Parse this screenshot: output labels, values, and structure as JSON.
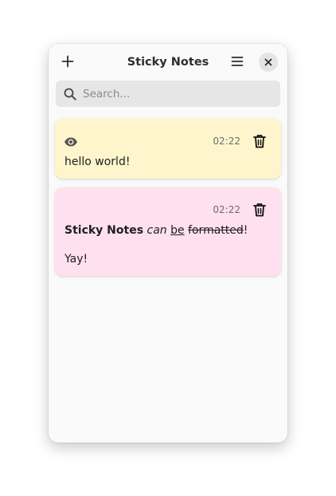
{
  "window": {
    "title": "Sticky Notes",
    "add_icon": "plus-icon",
    "menu_icon": "hamburger-menu-icon",
    "close_icon": "close-icon"
  },
  "search": {
    "placeholder": "Search...",
    "value": "",
    "icon": "search-icon"
  },
  "notes": [
    {
      "color": "#fff5cc",
      "time": "02:22",
      "icon": "eye-icon",
      "text": "hello world!"
    },
    {
      "color": "#ffe0ef",
      "time": "02:22",
      "line1": {
        "bold": "Sticky Notes",
        "italic": "can",
        "underline": "be",
        "strike": "formatted",
        "end": "!"
      },
      "line2": "Yay!"
    }
  ]
}
